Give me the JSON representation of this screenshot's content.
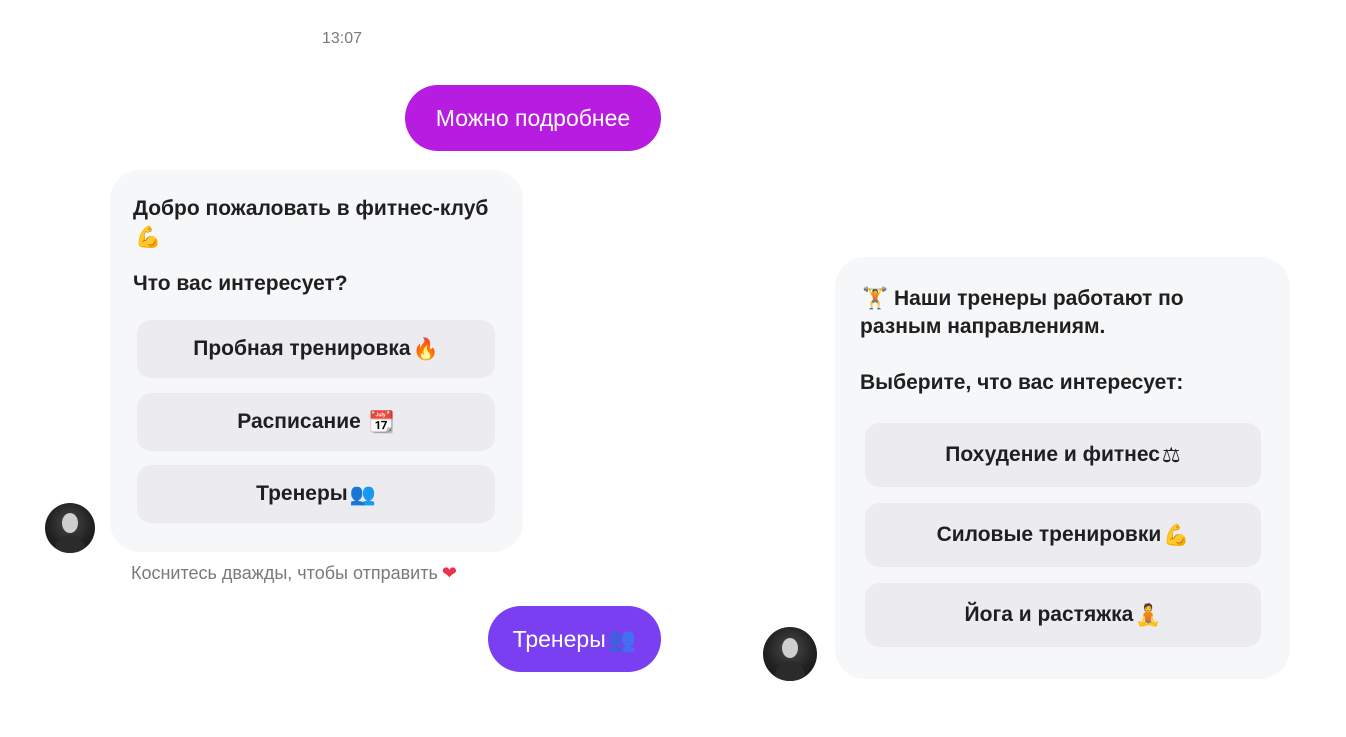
{
  "chat": {
    "timestamp": "13:07",
    "outgoing_1": "Можно подробнее",
    "outgoing_2_text": "Тренеры",
    "outgoing_2_emoji": "👥",
    "hint_text": "Коснитесь дважды, чтобы отправить",
    "hint_emoji": "❤",
    "card1": {
      "title": "Добро пожаловать в фитнес-клуб",
      "title_emoji": "💪",
      "question": "Что вас интересует?",
      "options": [
        {
          "label": "Пробная тренировка",
          "emoji": "🔥"
        },
        {
          "label": "Расписание ",
          "emoji": "📆"
        },
        {
          "label": "Тренеры",
          "emoji": "👥"
        }
      ]
    },
    "card2": {
      "title_emoji": "🏋",
      "title_line1": " Наши тренеры работают по",
      "title_line2": "разным направлениям.",
      "question": "Выберите, что вас интересует:",
      "options": [
        {
          "label": "Похудение и фитнес",
          "emoji": "⚖"
        },
        {
          "label": "Силовые тренировки",
          "emoji": "💪"
        },
        {
          "label": "Йога и растяжка",
          "emoji": "🧘"
        }
      ]
    }
  },
  "colors": {
    "outgoing_1_bg": "#b81ce0",
    "outgoing_2_bg": "#7a3ff1",
    "card_bg": "#f6f7f9",
    "option_bg": "#ececf0"
  }
}
